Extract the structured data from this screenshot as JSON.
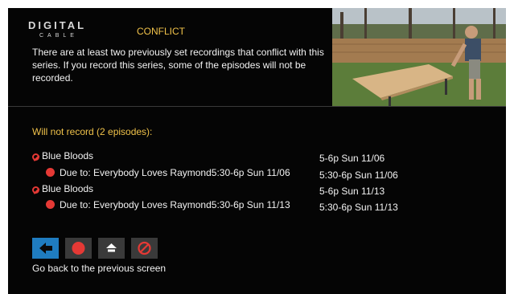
{
  "header": {
    "logo_main": "DIGITAL",
    "logo_sub": "CABLE",
    "title": "CONFLICT"
  },
  "message": "There are at least two previously set recordings that conflict with this series. If you record this series, some of the episodes will not be recorded.",
  "section_title": "Will not record (2 episodes):",
  "conflicts": [
    {
      "show": "Blue Bloods",
      "show_time": "5-6p  Sun 11/06",
      "due_to": "Due to: Everybody Loves Raymond5:30-6p  Sun 11/06",
      "due_time": "5:30-6p  Sun 11/06"
    },
    {
      "show": "Blue Bloods",
      "show_time": "5-6p  Sun 11/13",
      "due_to": "Due to: Everybody Loves Raymond5:30-6p  Sun 11/13",
      "due_time": "5:30-6p  Sun 11/13"
    }
  ],
  "buttons": [
    {
      "icon": "back-arrow-icon",
      "active": true
    },
    {
      "icon": "record-icon",
      "active": false
    },
    {
      "icon": "eject-icon",
      "active": false
    },
    {
      "icon": "cancel-icon",
      "active": false
    }
  ],
  "help_text": "Go back to the previous screen",
  "colors": {
    "accent_yellow": "#f0c24a",
    "record_red": "#e53935",
    "focus_blue": "#1f7cc0",
    "background": "#050505"
  }
}
